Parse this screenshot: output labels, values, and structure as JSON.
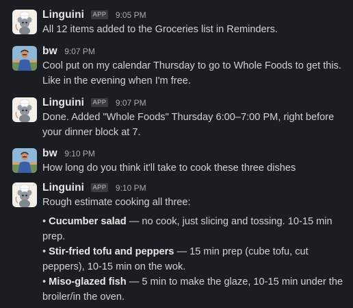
{
  "messages": [
    {
      "sender": "Linguini",
      "badge": "APP",
      "time": "9:05 PM",
      "avatar": "chef-rat-avatar",
      "text": "All 12 items added to the Groceries list in Reminders."
    },
    {
      "sender": "bw",
      "time": "9:07 PM",
      "avatar": "user-photo-avatar",
      "text": "Cool put on my calendar Thursday to go to Whole Foods to get this. Like in the evening when I'm free."
    },
    {
      "sender": "Linguini",
      "badge": "APP",
      "time": "9:07 PM",
      "avatar": "chef-rat-avatar",
      "text": "Done. Added \"Whole Foods\" Thursday 6:00–7:00 PM, right before your dinner block at 7."
    },
    {
      "sender": "bw",
      "time": "9:10 PM",
      "avatar": "user-photo-avatar",
      "text": "How long do you think it'll take to cook these three dishes"
    },
    {
      "sender": "Linguini",
      "badge": "APP",
      "time": "9:10 PM",
      "avatar": "chef-rat-avatar",
      "text": "Rough estimate cooking all three:",
      "bullets": [
        {
          "bold": "Cucumber salad",
          "rest": " — no cook, just slicing and tossing. 10-15 min prep."
        },
        {
          "bold": "Stir-fried tofu and peppers",
          "rest": " — 15 min prep (cube tofu, cut peppers), 10-15 min on the wok."
        },
        {
          "bold": "Miso-glazed fish",
          "rest": " — 5 min to make the glaze, 10-15 min under the broiler/in the oven."
        }
      ]
    }
  ],
  "bullet_marker": "•",
  "colors": {
    "background": "#1a1d21",
    "text": "#d1d2d3",
    "name": "#e8e8e8",
    "timestamp": "#a9aaad",
    "badge_bg": "#3a3c40"
  }
}
